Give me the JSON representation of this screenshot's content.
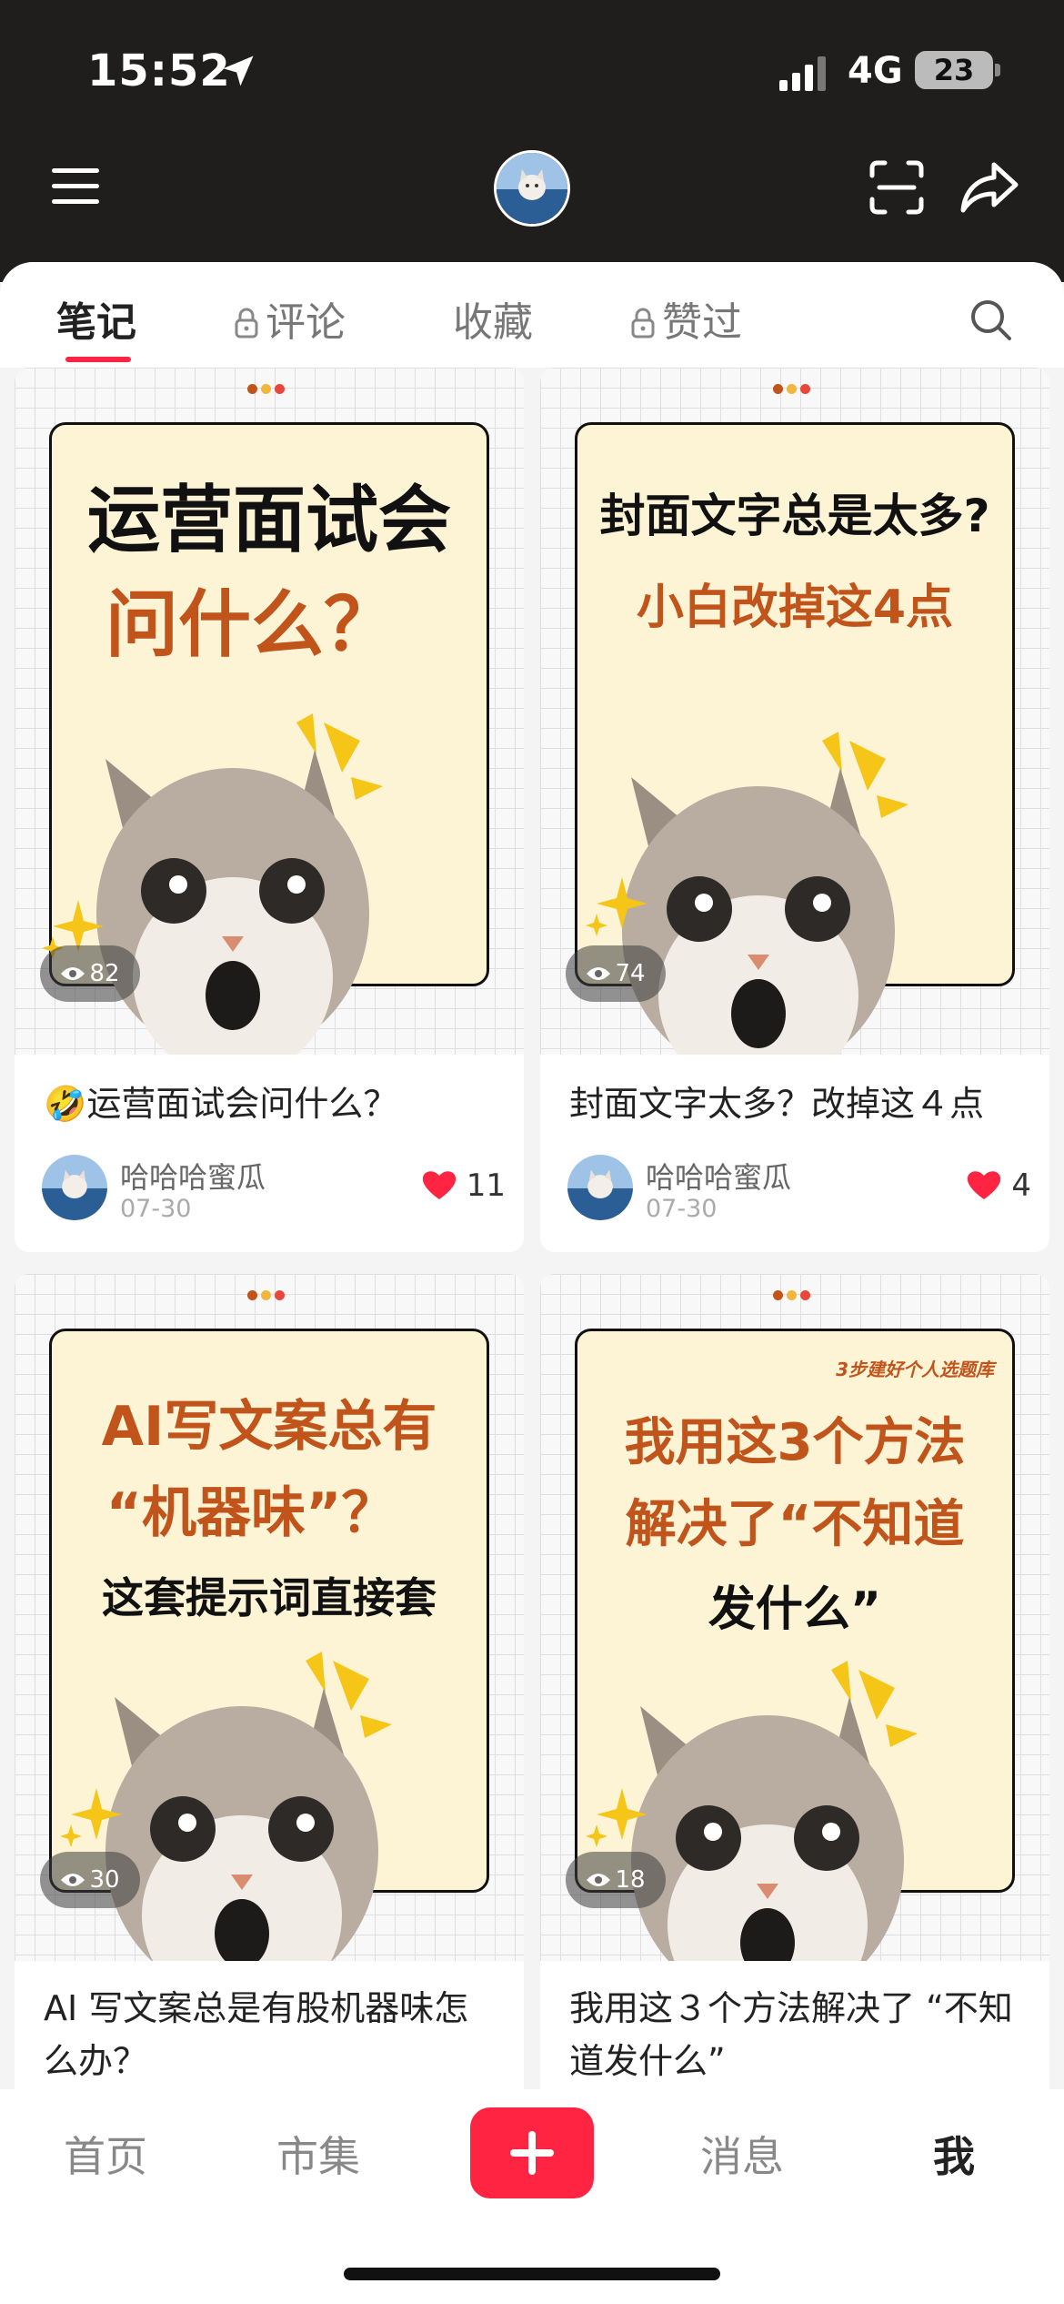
{
  "status_bar": {
    "time": "15:52",
    "network": "4G",
    "battery": "23"
  },
  "tabs": [
    {
      "label": "笔记",
      "locked": false
    },
    {
      "label": "评论",
      "locked": true
    },
    {
      "label": "收藏",
      "locked": false
    },
    {
      "label": "赞过",
      "locked": true
    }
  ],
  "icons": {
    "menu": "hamburger-menu-icon",
    "scan": "scan-icon",
    "share": "share-arrow-icon",
    "search": "search-icon",
    "views": "eye-icon",
    "likes": "heart-icon",
    "publish": "plus-icon"
  },
  "colors": {
    "accent": "#ff2442",
    "top_bar": "#1f1e1c",
    "poster_bg": "#fdf4d6",
    "poster_black": "#111111",
    "poster_orange": "#c0541b"
  },
  "notes": [
    {
      "poster_lines": [
        "运营面试会",
        "问什么？"
      ],
      "views": "82",
      "title": "🤣运营面试会问什么？",
      "author": "哈哈哈蜜瓜",
      "date": "07-30",
      "likes": "11"
    },
    {
      "poster_lines": [
        "封面文字总是太多?",
        "小白改掉这4点"
      ],
      "views": "74",
      "title": "封面文字太多？改掉这４点",
      "author": "哈哈哈蜜瓜",
      "date": "07-30",
      "likes": "4"
    },
    {
      "poster_lines": [
        "AI写文案总有",
        "“机器味”？",
        "这套提示词直接套"
      ],
      "views": "30",
      "title": "AI 写文案总是有股机器味怎么办？"
    },
    {
      "poster_tag": "3步建好个人选题库",
      "poster_lines": [
        "我用这3个方法",
        "解决了“不知道",
        "发什么”"
      ],
      "views": "18",
      "title": "我用这３个方法解决了 “不知道发什么”"
    }
  ],
  "bottom_nav": {
    "home": "首页",
    "market": "市集",
    "messages": "消息",
    "me": "我"
  }
}
